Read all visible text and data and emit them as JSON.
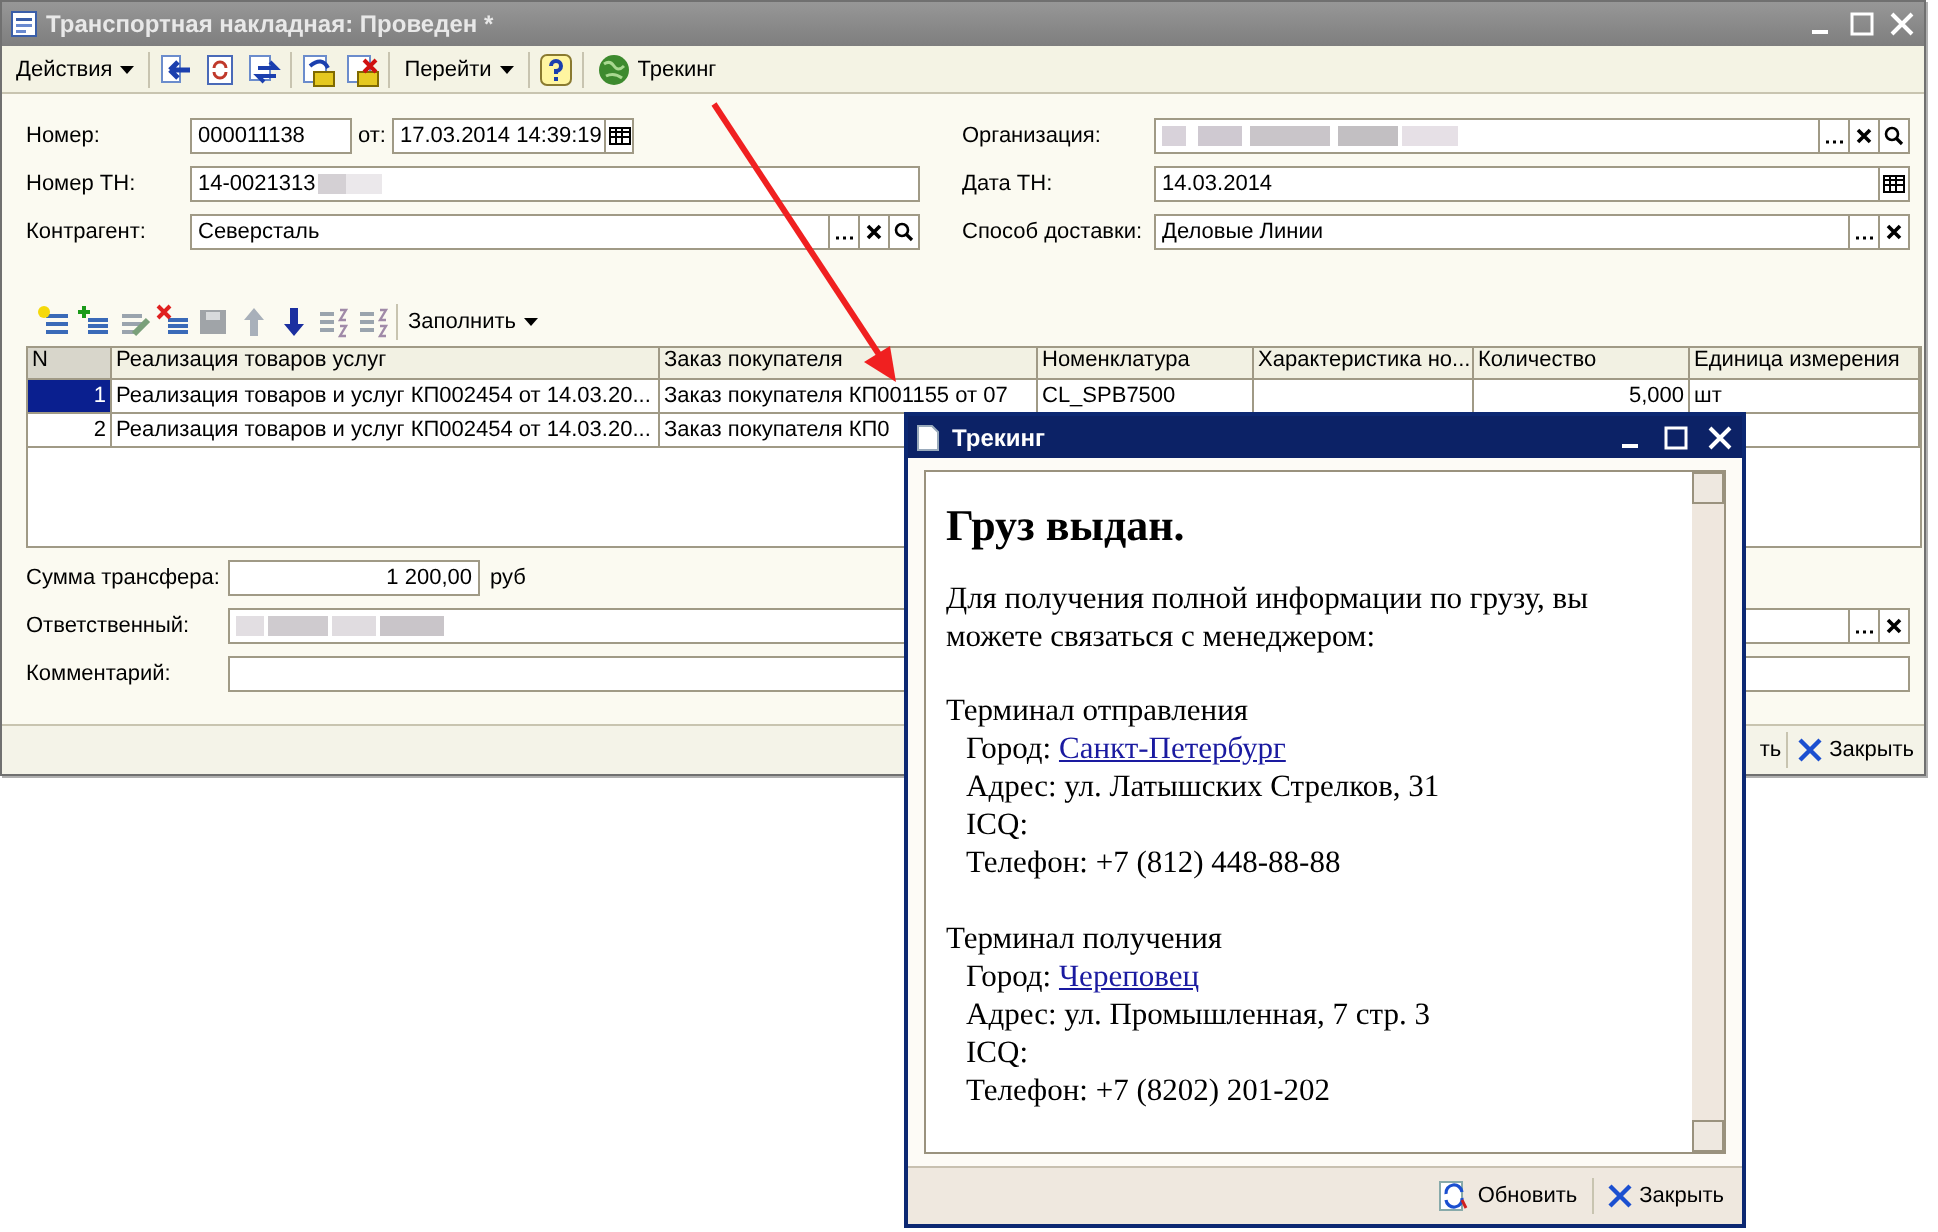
{
  "main_window": {
    "title": "Транспортная накладная: Проведен *",
    "toolbar": {
      "actions_menu": "Действия",
      "goto_menu": "Перейти",
      "tracking_button": "Трекинг"
    },
    "header": {
      "number_label": "Номер:",
      "number": "000011138",
      "date_label": "от:",
      "date": "17.03.2014 14:39:19",
      "tn_number_label": "Номер ТН:",
      "tn_number": "14-0021313",
      "counterparty_label": "Контрагент:",
      "counterparty": "Северсталь",
      "organization_label": "Организация:",
      "tn_date_label": "Дата ТН:",
      "tn_date": "14.03.2014",
      "delivery_label": "Способ доставки:",
      "delivery": "Деловые Линии"
    },
    "table_toolbar": {
      "fill_menu": "Заполнить"
    },
    "table": {
      "columns": [
        "N",
        "Реализация товаров услуг",
        "Заказ покупателя",
        "Номенклатура",
        "Характеристика но...",
        "Количество",
        "Единица измерения"
      ],
      "rows": [
        {
          "selected": true,
          "n": "1",
          "realization": "Реализация товаров и услуг КП002454 от 14.03.20...",
          "order": "Заказ покупателя КП001155 от 07",
          "nomenclature": "CL_SPB7500",
          "quantity": "5,000",
          "unit": "шт"
        },
        {
          "selected": false,
          "n": "2",
          "realization": "Реализация товаров и услуг КП002454 от 14.03.20...",
          "order": "Заказ покупателя КП0"
        }
      ]
    },
    "footer": {
      "transfer_label": "Сумма трансфера:",
      "transfer_amount": "1 200,00",
      "currency": "руб",
      "responsible_label": "Ответственный:",
      "comment_label": "Комментарий:"
    },
    "buttons": {
      "save_partial": "ть",
      "close": "Закрыть"
    }
  },
  "tracking_dialog": {
    "title": "Трекинг",
    "heading": "Груз выдан.",
    "intro": "Для получения полной информации по грузу, вы можете связаться с менеджером:",
    "terminals": [
      {
        "title": "Терминал отправления",
        "city_label": "Город:",
        "city": "Санкт-Петербург",
        "address": "Адрес: ул. Латышских Стрелков, 31",
        "icq": "ICQ:",
        "phone": "Телефон: +7 (812) 448-88-88"
      },
      {
        "title": "Терминал получения",
        "city_label": "Город:",
        "city": "Череповец",
        "address": "Адрес: ул. Промышленная, 7 стр. 3",
        "icq": "ICQ:",
        "phone": "Телефон: +7 (8202) 201-202"
      }
    ],
    "buttons": {
      "refresh": "Обновить",
      "close": "Закрыть"
    }
  }
}
